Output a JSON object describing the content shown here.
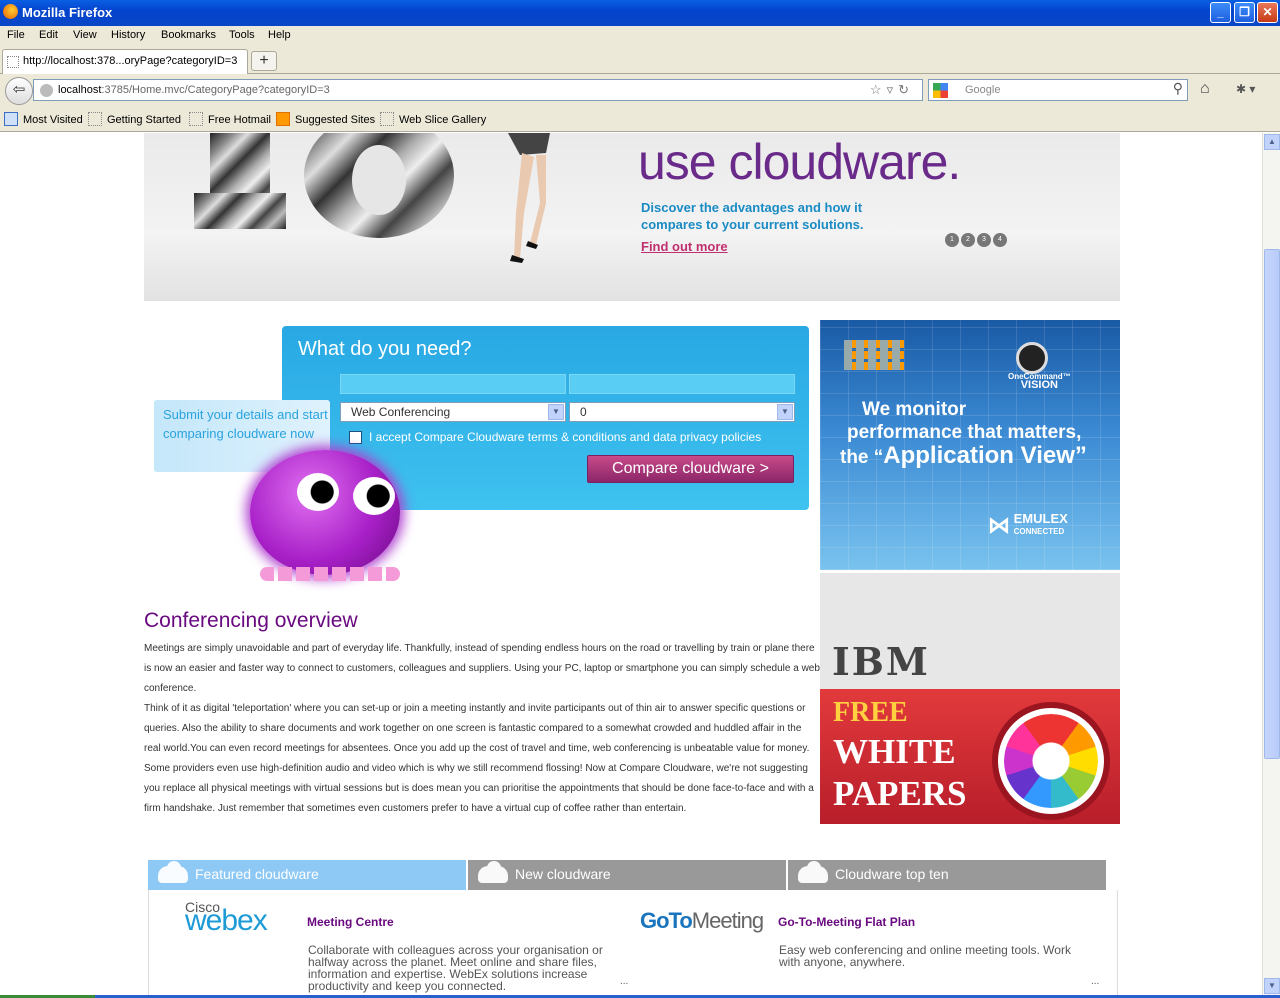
{
  "browser": {
    "window_title": "Mozilla Firefox",
    "menu": [
      "File",
      "Edit",
      "View",
      "History",
      "Bookmarks",
      "Tools",
      "Help"
    ],
    "tab_title": "http://localhost:378...oryPage?categoryID=3",
    "url_host": "localhost",
    "url_rest": ":3785/Home.mvc/CategoryPage?categoryID=3",
    "search_placeholder": "Google",
    "bookmarks": [
      "Most Visited",
      "Getting Started",
      "Free Hotmail",
      "Suggested Sites",
      "Web Slice Gallery"
    ]
  },
  "banner": {
    "headline": "use cloudware.",
    "subtext": "Discover the advantages and how it compares to your current solutions.",
    "link": "Find out more",
    "slides": [
      "1",
      "2",
      "3",
      "4"
    ]
  },
  "form": {
    "title": "What do you need?",
    "category_value": "Web Conferencing",
    "count_value": "0",
    "terms_label": "I accept Compare Cloudware terms & conditions and data privacy policies",
    "submit_label": "Compare cloudware >",
    "bubble_text": "Submit your details and start comparing cloudware now"
  },
  "ads": {
    "emulex": {
      "line1": "We monitor",
      "line2": "performance that matters,",
      "line3_pre": "the “",
      "line3_app": "Application View",
      "line3_post": "”",
      "product_1": "OneCommand™",
      "product_2": "VISION",
      "brand": "EMULEX",
      "brand_sub": "CONNECTED"
    },
    "ibm": {
      "logo": "IBM",
      "free": "FREE",
      "white": "WHITE",
      "papers": "PAPERS"
    }
  },
  "overview": {
    "title": "Conferencing overview",
    "paragraphs": [
      "Meetings are simply unavoidable and part of everyday life. Thankfully, instead of spending endless hours on the road or travelling by train or plane there is now an easier and faster way to connect to customers, colleagues and suppliers. Using your PC, laptop or smartphone you can simply schedule a web conference.",
      "Think of it as digital 'teleportation' where you can set-up or join a meeting instantly and invite participants out of thin air to answer specific questions or queries. Also the ability to share documents and work together on one screen is fantastic compared to a somewhat crowded and huddled affair in the real world.You can even record meetings for absentees. Once you add up the cost of travel and time, web conferencing is unbeatable value for money.",
      "Some providers even use high-definition audio and video which is why we still recommend flossing! Now at Compare Cloudware, we're not suggesting you replace all physical meetings with virtual sessions but is does mean you can prioritise the appointments that should be done face-to-face and with a firm handshake. Just remember that sometimes even customers prefer to have a virtual cup of coffee rather than entertain."
    ]
  },
  "tabs": [
    "Featured cloudware",
    "New cloudware",
    "Cloudware top ten"
  ],
  "products": [
    {
      "logo_top": "Cisco",
      "logo_main": "webex",
      "name": "Meeting Centre",
      "desc": "Collaborate with colleagues across your organisation or halfway across the planet. Meet online and share files, information and expertise. WebEx solutions increase productivity and keep you connected.",
      "more": "..."
    },
    {
      "logo_main": "GoTo",
      "logo_sub": "Meeting",
      "name": "Go-To-Meeting Flat Plan",
      "desc": "Easy web conferencing and online meeting tools. Work with anyone, anywhere.",
      "more": "..."
    }
  ]
}
